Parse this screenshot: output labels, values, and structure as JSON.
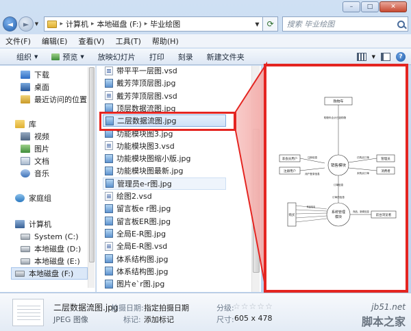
{
  "window": {
    "caption": {
      "minimize": "–",
      "maximize": "□",
      "close": "✕"
    }
  },
  "address": {
    "back": "◄",
    "forward": "►",
    "crumbs": [
      "计算机",
      "本地磁盘 (F:)",
      "毕业绘图"
    ],
    "refresh": "⟳",
    "search_placeholder": "搜索 毕业绘图"
  },
  "menu": [
    "文件(F)",
    "编辑(E)",
    "查看(V)",
    "工具(T)",
    "帮助(H)"
  ],
  "toolbar": {
    "items": [
      "组织",
      "预览",
      "放映幻灯片",
      "打印",
      "刻录",
      "新建文件夹"
    ],
    "help": "?"
  },
  "nav": {
    "items": [
      {
        "label": "下载",
        "icon": "download-folder-icon"
      },
      {
        "label": "桌面",
        "icon": "desktop-icon"
      },
      {
        "label": "最近访问的位置",
        "icon": "recent-places-icon"
      },
      {
        "label": "库",
        "icon": "library-icon"
      },
      {
        "label": "视频",
        "icon": "videos-icon"
      },
      {
        "label": "图片",
        "icon": "pictures-icon"
      },
      {
        "label": "文档",
        "icon": "documents-icon"
      },
      {
        "label": "音乐",
        "icon": "music-icon"
      },
      {
        "label": "家庭组",
        "icon": "homegroup-icon"
      },
      {
        "label": "计算机",
        "icon": "computer-icon"
      },
      {
        "label": "System (C:)",
        "icon": "drive-icon"
      },
      {
        "label": "本地磁盘 (D:)",
        "icon": "drive-icon"
      },
      {
        "label": "本地磁盘 (E:)",
        "icon": "drive-icon"
      },
      {
        "label": "本地磁盘 (F:)",
        "icon": "drive-icon"
      },
      {
        "label": "网络",
        "icon": "network-icon"
      }
    ]
  },
  "files": [
    {
      "name": "带平平一层图.vsd",
      "type": "vsd"
    },
    {
      "name": "戴芳萍顶层图.jpg",
      "type": "jpg"
    },
    {
      "name": "戴芳萍顶层图.vsd",
      "type": "vsd"
    },
    {
      "name": "顶层数据流图.jpg",
      "type": "jpg"
    },
    {
      "name": "二层数据流图.jpg",
      "type": "jpg"
    },
    {
      "name": "功能模块图3.jpg",
      "type": "jpg"
    },
    {
      "name": "功能模块图3.vsd",
      "type": "vsd"
    },
    {
      "name": "功能模块图缩小版.jpg",
      "type": "jpg"
    },
    {
      "name": "功能模块图最新.jpg",
      "type": "jpg"
    },
    {
      "name": "管理员e-r图.jpg",
      "type": "jpg"
    },
    {
      "name": "绘图2.vsd",
      "type": "vsd"
    },
    {
      "name": "留言板e r图.jpg",
      "type": "jpg"
    },
    {
      "name": "留言板ER图.jpg",
      "type": "jpg"
    },
    {
      "name": "全局E-R图.jpg",
      "type": "jpg"
    },
    {
      "name": "全局E-R图.vsd",
      "type": "vsd"
    },
    {
      "name": "体系结构图.jpg",
      "type": "jpg"
    },
    {
      "name": "体系结构图.jpg",
      "type": "jpg"
    },
    {
      "name": "图片e`r图.jpg",
      "type": "jpg"
    },
    {
      "name": "图片ER图.jpg",
      "type": "jpg"
    }
  ],
  "selected_index": 4,
  "hover_index": 9,
  "preview": {
    "nodes": {
      "cart": "购物车",
      "member": "非会员用户",
      "reg_user": "注册用户",
      "sales": "销售模块",
      "admin": "管理员",
      "consumer": "消费者",
      "sys_mgmt": "系统管理\n模块",
      "buyer": "购买",
      "frontend": "前台浏览者"
    },
    "edge_labels": {
      "e1": "购物车合计已选购物",
      "e2": "注册信息",
      "e3": "用户登录信息",
      "e4": "订单信息",
      "e5": "订单的信息",
      "e6": "已购买订单",
      "e7": "未购买订单",
      "e8": "商品信息",
      "e9": "商品、新闻信息"
    }
  },
  "details": {
    "name": "二层数据流图.jpg",
    "type": "JPEG 图像",
    "shot_date_label": "拍摄日期:",
    "shot_date_value": "指定拍摄日期",
    "tags_label": "标记:",
    "tags_value": "添加标记",
    "rating_label": "分级:",
    "rating": 0,
    "rating_max": 5,
    "size_label": "尺寸:",
    "size_value": "605 x 478"
  },
  "watermark": {
    "site": "jb51.net",
    "name": "脚本之家"
  },
  "colors": {
    "highlight_red": "#e42521",
    "selection_blue": "#84acdd"
  }
}
